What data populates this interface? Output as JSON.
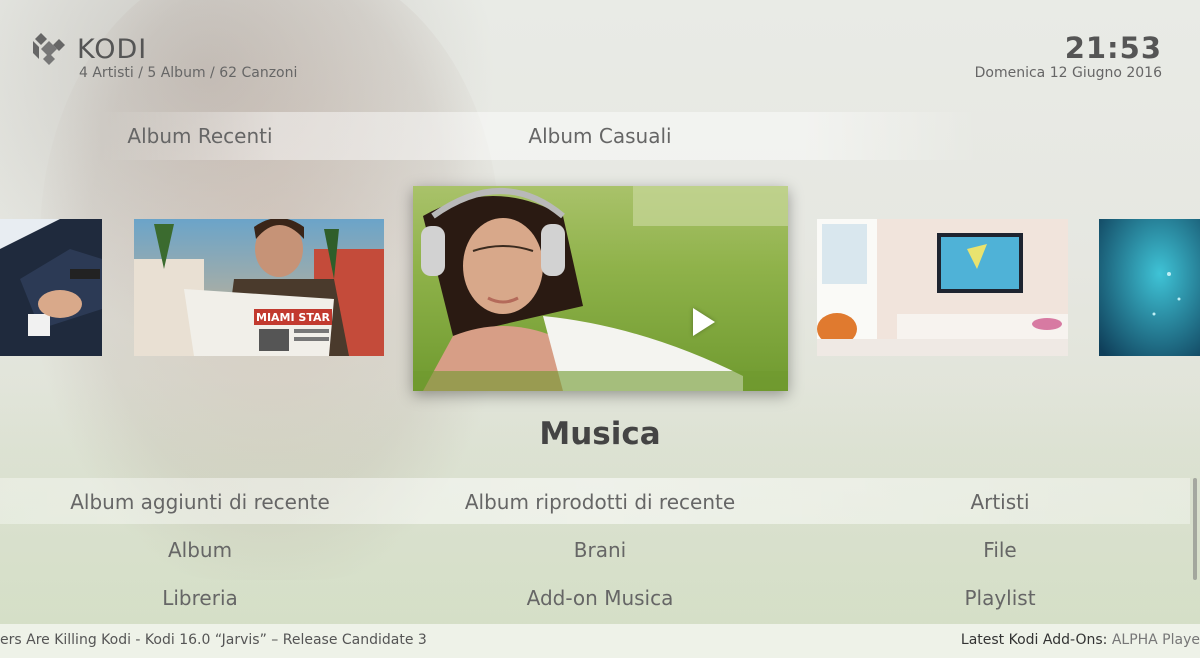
{
  "header": {
    "app_name": "KODI",
    "library_summary": "4 Artisti / 5 Album / 62 Canzoni",
    "time": "21:53",
    "date": "Domenica 12 Giugno 2016"
  },
  "tabs": [
    {
      "label": "Album Recenti"
    },
    {
      "label": "Album Casuali"
    }
  ],
  "carousel": {
    "items": [
      {
        "icon": "suit-gun-thumbnail"
      },
      {
        "icon": "dexter-miami-star-thumbnail"
      },
      {
        "icon": "woman-headphones-thumbnail",
        "focused": true
      },
      {
        "icon": "living-room-tv-thumbnail"
      },
      {
        "icon": "underwater-thumbnail"
      }
    ],
    "newspaper_headline": "MIAMI STAR"
  },
  "section": {
    "title": "Musica"
  },
  "menu": {
    "rows": [
      [
        "Album aggiunti di recente",
        "Album riprodotti di recente",
        "Artisti"
      ],
      [
        "Album",
        "Brani",
        "File"
      ],
      [
        "Libreria",
        "Add-on Musica",
        "Playlist"
      ]
    ]
  },
  "footer": {
    "ticker": "ers Are Killing Kodi - Kodi 16.0 “Jarvis” – Release Candidate 3",
    "addons_label": "Latest Kodi Add-Ons:",
    "addons_value": "ALPHA Playe"
  },
  "colors": {
    "accent": "#555555",
    "background": "#e8eae4"
  }
}
